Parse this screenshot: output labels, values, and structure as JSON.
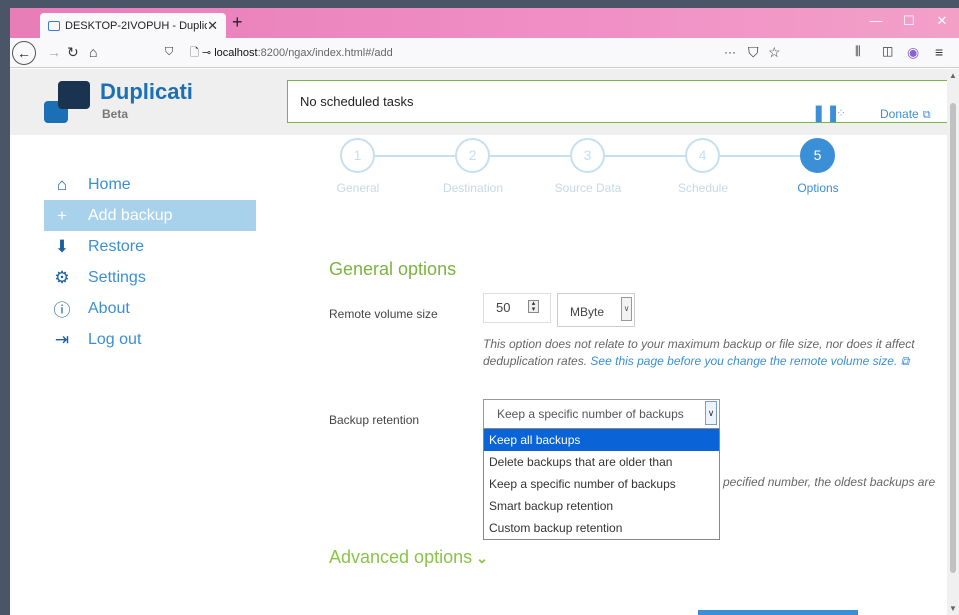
{
  "browser": {
    "tab_title": "DESKTOP-2IVOPUH - Duplicati",
    "tab_close": "✕",
    "new_tab": "+",
    "url_host": "localhost",
    "url_path": ":8200/ngax/index.html#/add",
    "nav_more": "···"
  },
  "header": {
    "brand": "Duplicati",
    "beta": "Beta",
    "status": "No scheduled tasks",
    "donate": "Donate"
  },
  "sidebar": {
    "items": [
      {
        "label": "Home",
        "icon": "home-icon"
      },
      {
        "label": "Add backup",
        "icon": "plus-icon"
      },
      {
        "label": "Restore",
        "icon": "restore-icon"
      },
      {
        "label": "Settings",
        "icon": "gear-icon"
      },
      {
        "label": "About",
        "icon": "info-icon"
      },
      {
        "label": "Log out",
        "icon": "logout-icon"
      }
    ]
  },
  "steps": [
    {
      "num": "1",
      "label": "General"
    },
    {
      "num": "2",
      "label": "Destination"
    },
    {
      "num": "3",
      "label": "Source Data"
    },
    {
      "num": "4",
      "label": "Schedule"
    },
    {
      "num": "5",
      "label": "Options"
    }
  ],
  "options": {
    "section_title": "General options",
    "remote_volume_label": "Remote volume size",
    "remote_volume_value": "50",
    "unit": "MByte",
    "help_text": "This option does not relate to your maximum backup or file size, nor does it affect deduplication rates.",
    "help_link": "See this page before you change the remote volume size.",
    "retention_label": "Backup retention",
    "retention_selected": "Keep a specific number of backups",
    "retention_options": [
      "Keep all backups",
      "Delete backups that are older than",
      "Keep a specific number of backups",
      "Smart backup retention",
      "Custom backup retention"
    ],
    "retention_help_partial": "pecified number, the oldest backups are",
    "advanced_title": "Advanced options"
  },
  "colors": {
    "accent": "#3b8fd6",
    "green": "#7cb342",
    "selected": "#0a64d8"
  }
}
